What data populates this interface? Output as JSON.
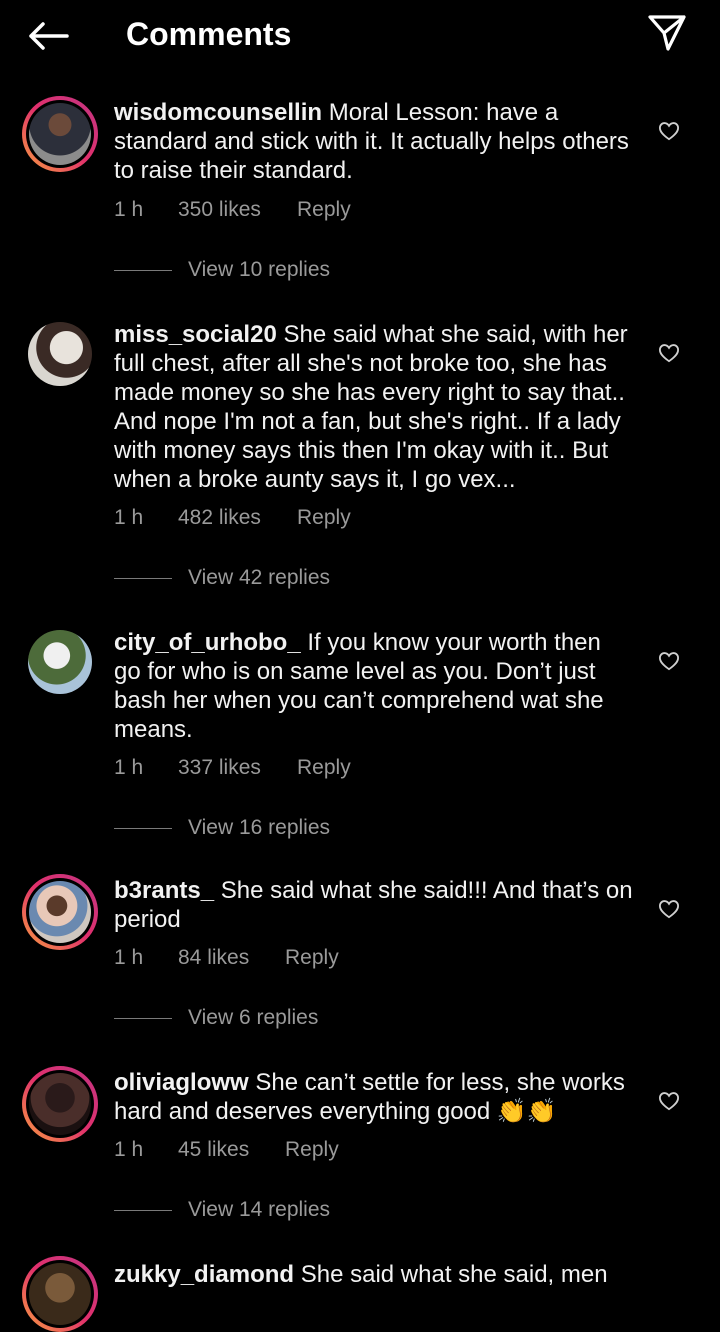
{
  "header": {
    "title": "Comments",
    "back_icon": "arrow-left-icon",
    "share_icon": "paper-plane-icon"
  },
  "colors": {
    "background": "#000000",
    "text": "#ffffff",
    "secondary_text": "#9a9a9a",
    "story_ring": [
      "#f9a03f",
      "#e1306c",
      "#c13584"
    ]
  },
  "comments": [
    {
      "username": "wisdomcounsellin",
      "text": "Moral Lesson: have a standard and stick with it. It actually helps others to raise their standard.",
      "time": "1 h",
      "likes": "350 likes",
      "reply": "Reply",
      "view_replies": "View 10 replies",
      "has_story_ring": true
    },
    {
      "username": "miss_social20",
      "text": "She said what she said, with her full chest, after all she's not broke too, she has made money so she has every right to say that.. And nope I'm not a fan, but she's right.. If a lady with money says this then I'm okay with it.. But when a broke aunty says it, I go vex...",
      "time": "1 h",
      "likes": "482 likes",
      "reply": "Reply",
      "view_replies": "View 42 replies",
      "has_story_ring": false
    },
    {
      "username": "city_of_urhobo_",
      "text": "If you know your worth then go for who is on same level as you. Don’t just bash her when you can’t comprehend wat she means.",
      "time": "1 h",
      "likes": "337 likes",
      "reply": "Reply",
      "view_replies": "View 16 replies",
      "has_story_ring": false
    },
    {
      "username": "b3rants_",
      "text": "She said what she said!!! And that’s on period",
      "time": "1 h",
      "likes": "84 likes",
      "reply": "Reply",
      "view_replies": "View 6 replies",
      "has_story_ring": true
    },
    {
      "username": "oliviagloww",
      "text": "She can’t settle for less, she works hard and deserves everything good 👏👏",
      "time": "1 h",
      "likes": "45 likes",
      "reply": "Reply",
      "view_replies": "View 14 replies",
      "has_story_ring": true
    },
    {
      "username": "zukky_diamond",
      "text": "She said what she said, men",
      "has_story_ring": true
    }
  ]
}
